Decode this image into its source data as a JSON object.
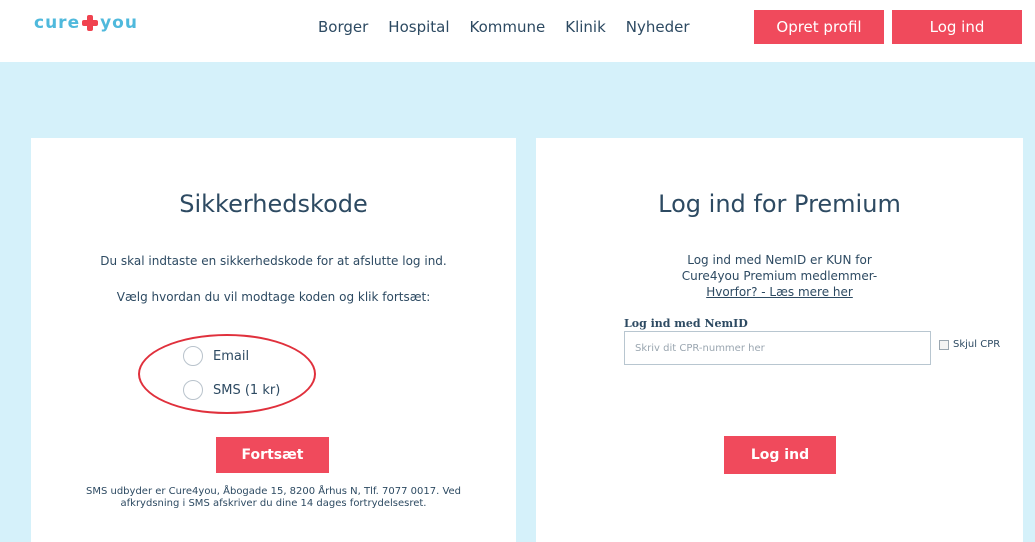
{
  "header": {
    "logo": {
      "left": "cure",
      "right": "you"
    },
    "nav": [
      "Borger",
      "Hospital",
      "Kommune",
      "Klinik",
      "Nyheder"
    ],
    "create_profile_label": "Opret profil",
    "login_label": "Log ind"
  },
  "colors": {
    "accent_red": "#f04a5c",
    "band_bg": "#d5f1fa",
    "text": "#2d4a62",
    "logo_blue": "#4fb9dc"
  },
  "security": {
    "title": "Sikkerhedskode",
    "instruction_1": "Du skal indtaste en sikkerhedskode for at afslutte log ind.",
    "instruction_2": "Vælg hvordan du vil modtage koden og klik fortsæt:",
    "options": [
      "Email",
      "SMS (1 kr)"
    ],
    "continue_label": "Fortsæt",
    "footnote": "SMS udbyder er Cure4you, Åbogade 15, 8200 Århus N, Tlf. 7077 0017. Ved afkrydsning i SMS afskriver du dine 14 dages fortrydelsesret."
  },
  "premium": {
    "title": "Log ind for Premium",
    "info_line_1": "Log ind med NemID er KUN for",
    "info_line_2": "Cure4you Premium medlemmer-",
    "info_link": "Hvorfor? - Læs mere her",
    "nemid_label": "Log ind med NemID",
    "cpr_placeholder": "Skriv dit CPR-nummer her",
    "hide_cpr_label": "Skjul CPR",
    "login_label": "Log ind"
  }
}
